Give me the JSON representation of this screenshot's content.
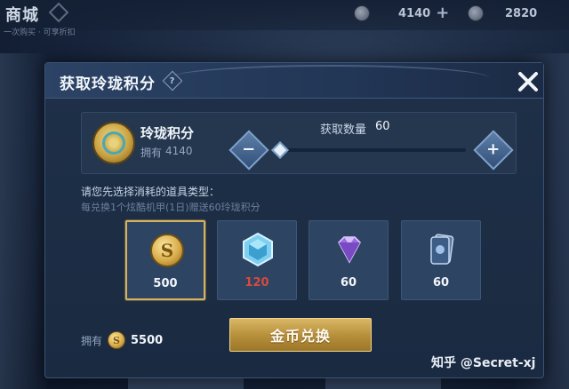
{
  "background": {
    "store_title": "商城",
    "store_subtitle": "一次购买 · 可享折扣",
    "resources": [
      {
        "icon": "diamond-coin-icon",
        "value": "4140"
      },
      {
        "icon": "gem-coin-icon",
        "value": "2820"
      }
    ]
  },
  "dialog": {
    "title": "获取玲珑积分",
    "help_icon": "?",
    "points": {
      "name": "玲珑积分",
      "owned_label": "拥有",
      "owned_value": "4140"
    },
    "quantity": {
      "label": "获取数量",
      "value": "60",
      "minus": "−",
      "plus": "+"
    },
    "choose_text": "请您先选择消耗的道具类型：",
    "exchange_note": "每兑换1个炫酷机甲(1日)赠送60玲珑积分",
    "items": [
      {
        "name": "gold-coin",
        "icon": "gold-coin-icon",
        "count": "500",
        "selected": true
      },
      {
        "name": "ice-crystal",
        "icon": "ice-crystal-icon",
        "count": "120",
        "insufficient": true
      },
      {
        "name": "purple-diamond",
        "icon": "purple-diamond-icon",
        "count": "60"
      },
      {
        "name": "skin-card",
        "icon": "skin-card-icon",
        "count": "60"
      }
    ],
    "owned_gold": {
      "label": "拥有",
      "value": "5500",
      "coin_letter": "S"
    },
    "exchange_button": "金币兑换"
  },
  "watermark": "知乎 @Secret-xj",
  "colors": {
    "accent_gold": "#d6b25c",
    "insufficient_red": "#d94a3c",
    "panel": "#24374f"
  }
}
